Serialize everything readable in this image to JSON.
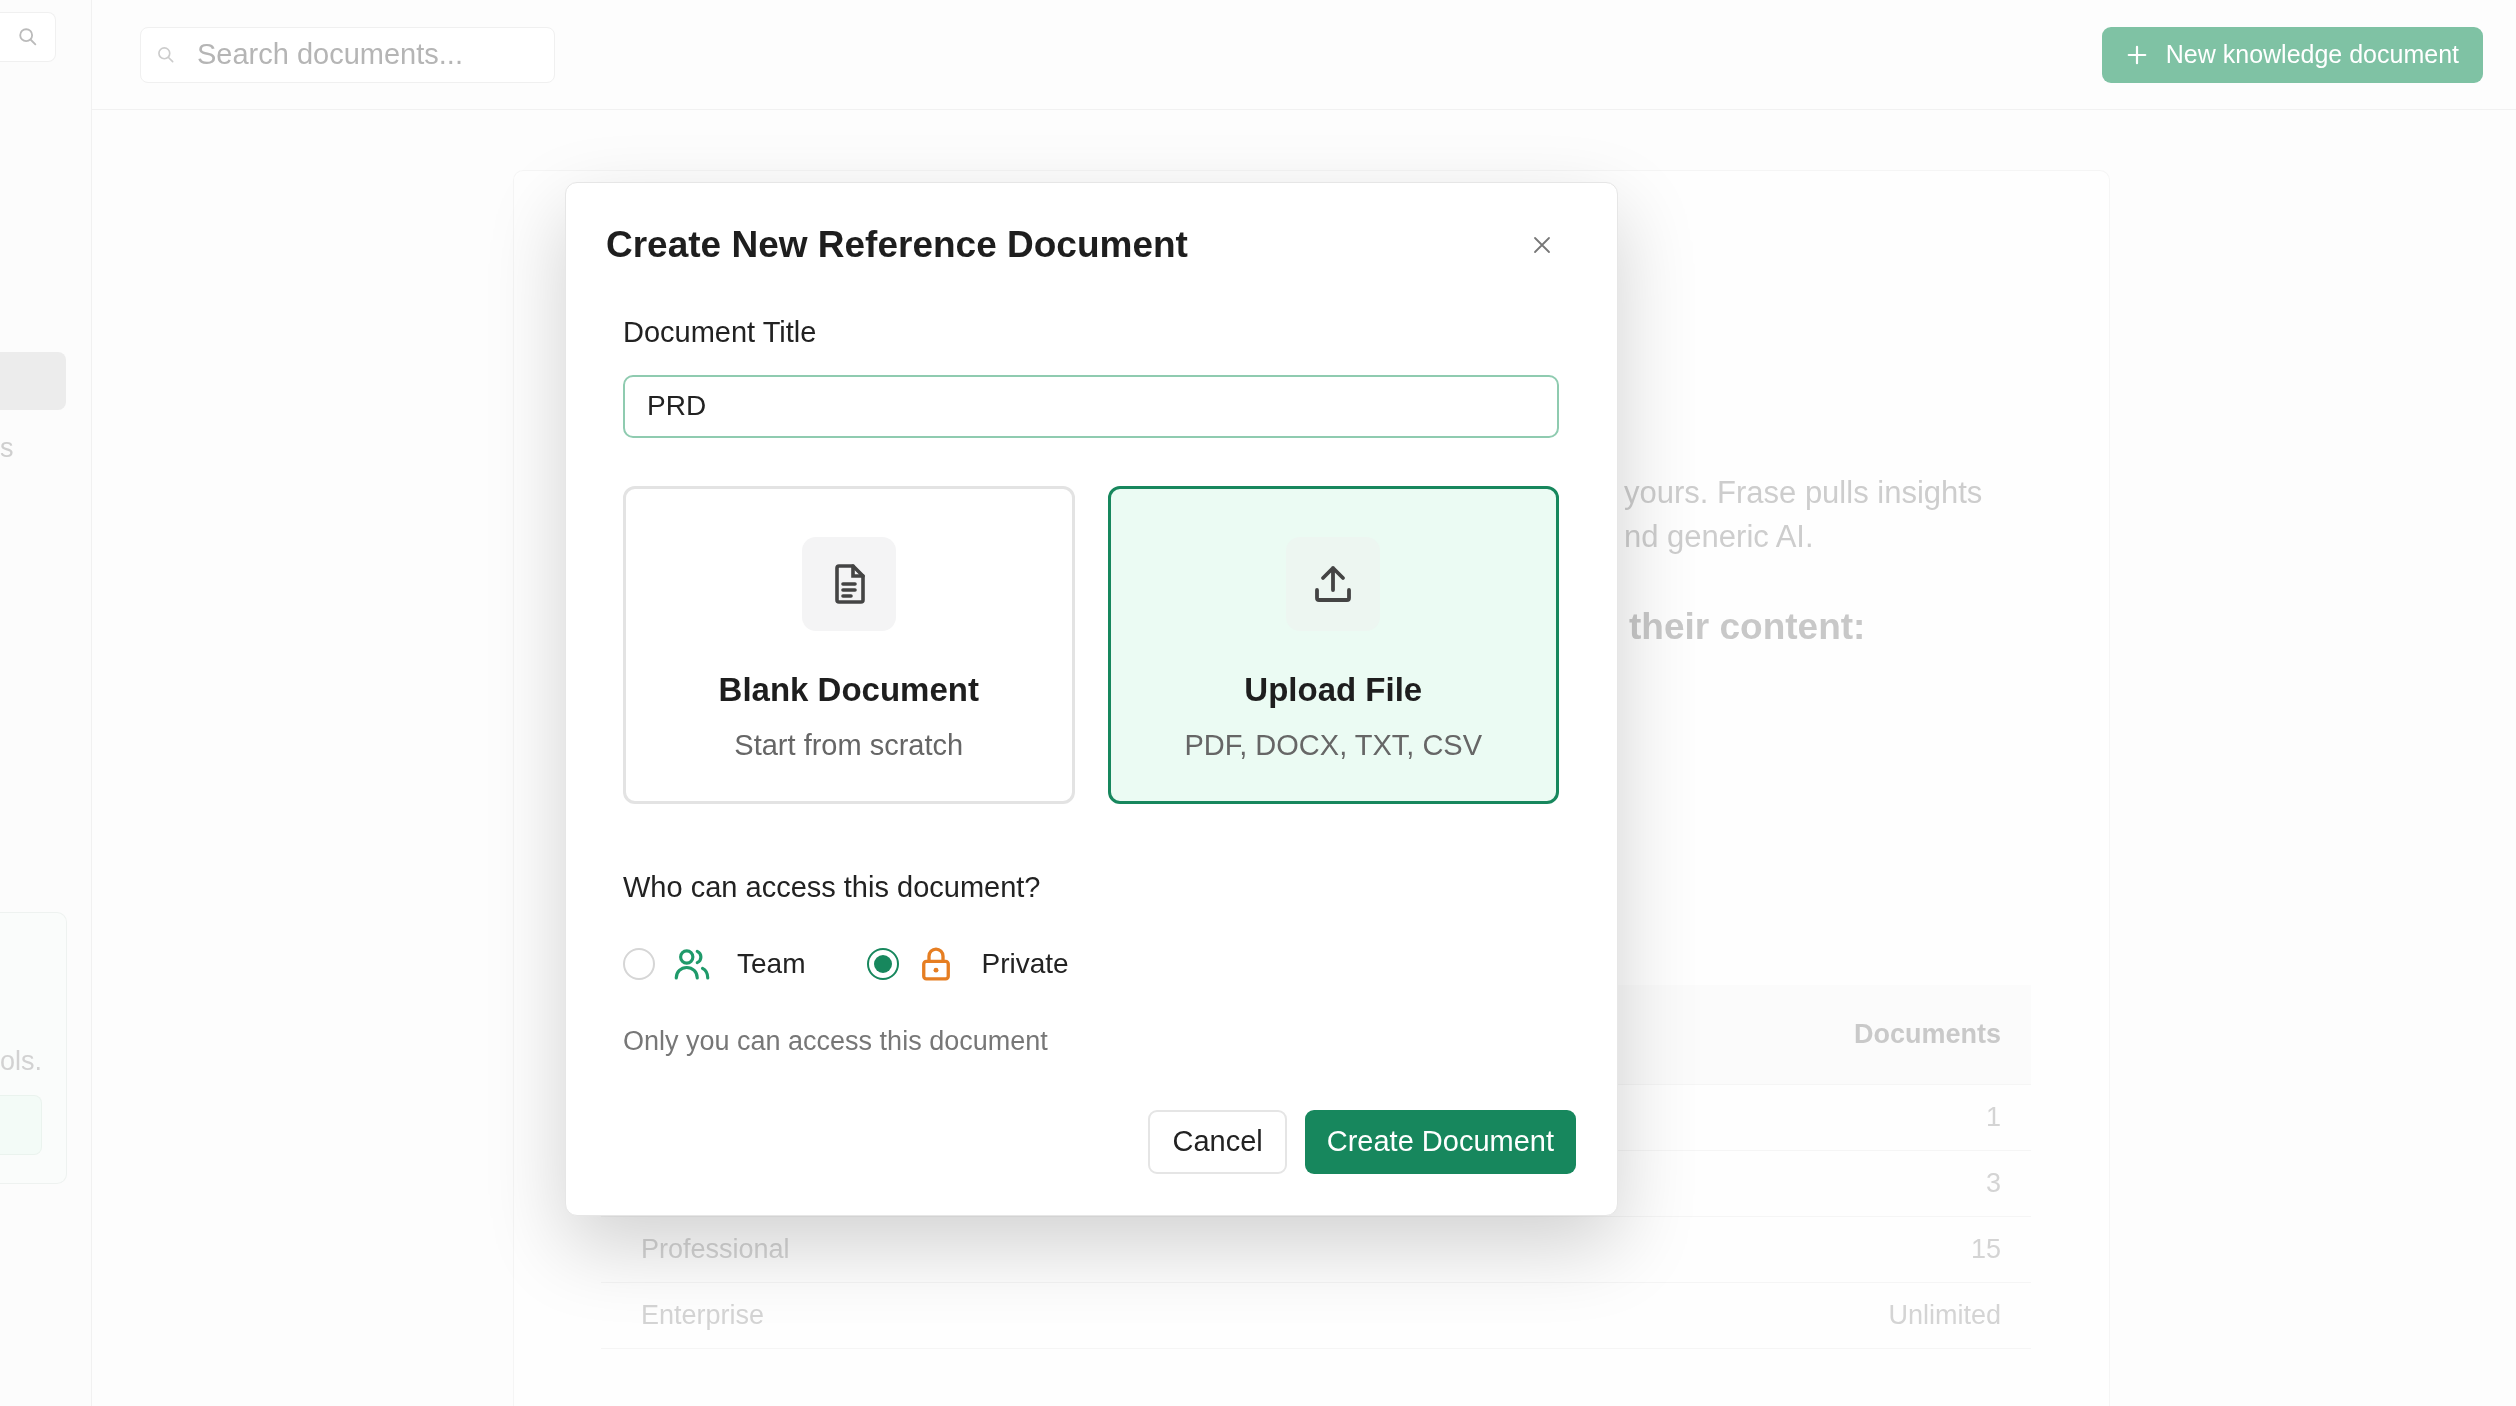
{
  "sidebar": {
    "texts": [
      "s",
      "ols."
    ]
  },
  "search": {
    "placeholder": "Search documents..."
  },
  "new_button": {
    "label": "New knowledge document"
  },
  "background": {
    "paragraph_lines": [
      "yours. Frase pulls insights",
      "nd generic AI."
    ],
    "heading": "their content:",
    "table": {
      "columns": [
        "Documents"
      ],
      "rows": [
        {
          "documents": "1"
        },
        {
          "documents": "3"
        },
        {
          "column_1": "Professional",
          "documents": "15"
        },
        {
          "column_1": "Enterprise",
          "documents": "Unlimited"
        }
      ]
    }
  },
  "dialog": {
    "title": "Create New Reference Document",
    "field": {
      "label": "Document Title",
      "value": "PRD"
    },
    "options": [
      {
        "kind": "blank",
        "title": "Blank Document",
        "subtitle": "Start from scratch",
        "selected": false
      },
      {
        "kind": "upload",
        "title": "Upload File",
        "subtitle": "PDF, DOCX, TXT, CSV",
        "selected": true
      }
    ],
    "access": {
      "question": "Who can access this document?",
      "options": [
        {
          "kind": "team",
          "label": "Team",
          "selected": false
        },
        {
          "kind": "private",
          "label": "Private",
          "selected": true
        }
      ],
      "note": "Only you can access this document"
    },
    "buttons": [
      {
        "kind": "cancel",
        "label": "Cancel"
      },
      {
        "kind": "create",
        "label": "Create Document"
      }
    ]
  }
}
